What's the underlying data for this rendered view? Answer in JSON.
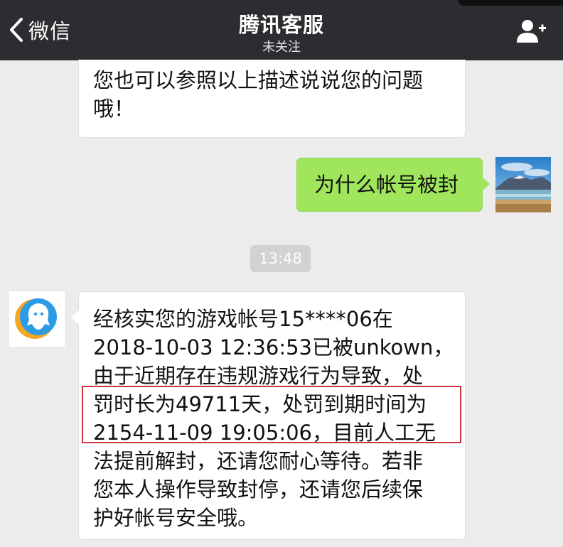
{
  "navbar": {
    "back_label": "微信",
    "title": "腾讯客服",
    "subtitle": "未关注"
  },
  "messages": [
    {
      "side": "left",
      "lines": [
        "您也可以参照以上描述说说您的问题",
        "哦！"
      ]
    },
    {
      "side": "right",
      "text": "为什么帐号被封"
    },
    {
      "side": "left",
      "lines": [
        "经核实您的游戏帐号15****06在",
        "2018-10-03 12:36:53已被unkown，",
        "由于近期存在违规游戏行为导致，处",
        "罚时长为49711天，处罚到期时间为",
        "2154-11-09 19:05:06，目前人工无",
        "法提前解封，还请您耐心等待。若非",
        "您本人操作导致封停，还请您后续保",
        "护好帐号安全哦。"
      ]
    }
  ],
  "timestamp": "13:48",
  "colors": {
    "navbar": "#2d2d31",
    "background": "#ececec",
    "sent_bubble": "#9fe65c",
    "received_bubble": "#ffffff",
    "highlight_box": "#c9383c"
  }
}
